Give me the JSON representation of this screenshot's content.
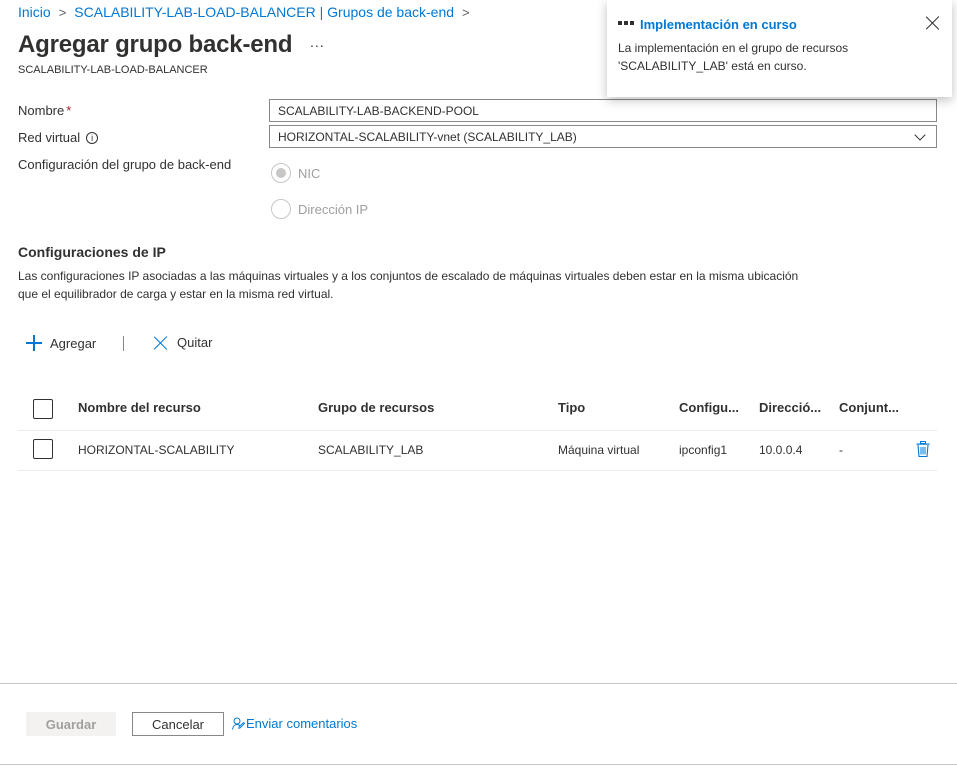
{
  "breadcrumb": {
    "items": [
      "Inicio",
      "SCALABILITY-LAB-LOAD-BALANCER | Grupos de back-end"
    ],
    "separator": ">"
  },
  "header": {
    "title": "Agregar grupo back-end",
    "more": "...",
    "subtitle": "SCALABILITY-LAB-LOAD-BALANCER"
  },
  "form": {
    "name_label": "Nombre",
    "required_mark": "*",
    "name_value": "SCALABILITY-LAB-BACKEND-POOL",
    "vnet_label": "Red virtual",
    "info_glyph": "i",
    "vnet_value": "HORIZONTAL-SCALABILITY-vnet (SCALABILITY_LAB)",
    "pool_config_label": "Configuración del grupo de back-end",
    "radio_options": [
      "NIC",
      "Dirección IP"
    ],
    "radio_selected": "NIC"
  },
  "ip_section": {
    "title": "Configuraciones de IP",
    "description": "Las configuraciones IP asociadas a las máquinas virtuales y a los conjuntos de escalado de máquinas virtuales deben estar en la misma ubicación que el equilibrador de carga y estar en la misma red virtual."
  },
  "toolbar": {
    "add_label": "Agregar",
    "divider": "|",
    "remove_label": "Quitar"
  },
  "table": {
    "columns": [
      "Nombre del recurso",
      "Grupo de recursos",
      "Tipo",
      "Configu...",
      "Direcció...",
      "Conjunt..."
    ],
    "rows": [
      [
        "HORIZONTAL-SCALABILITY",
        "SCALABILITY_LAB",
        "Máquina virtual",
        "ipconfig1",
        "10.0.0.4",
        "-"
      ]
    ]
  },
  "footer": {
    "save_label": "Guardar",
    "cancel_label": "Cancelar",
    "feedback_label": "Enviar comentarios"
  },
  "notification": {
    "title": "Implementación en curso",
    "body": "La implementación en el grupo de recursos 'SCALABILITY_LAB' está en curso."
  },
  "colors": {
    "accent": "#0078d4",
    "text": "#323130",
    "required": "#a4262c",
    "disabled_bg": "#f3f2f1",
    "disabled_text": "#a19f9d"
  }
}
